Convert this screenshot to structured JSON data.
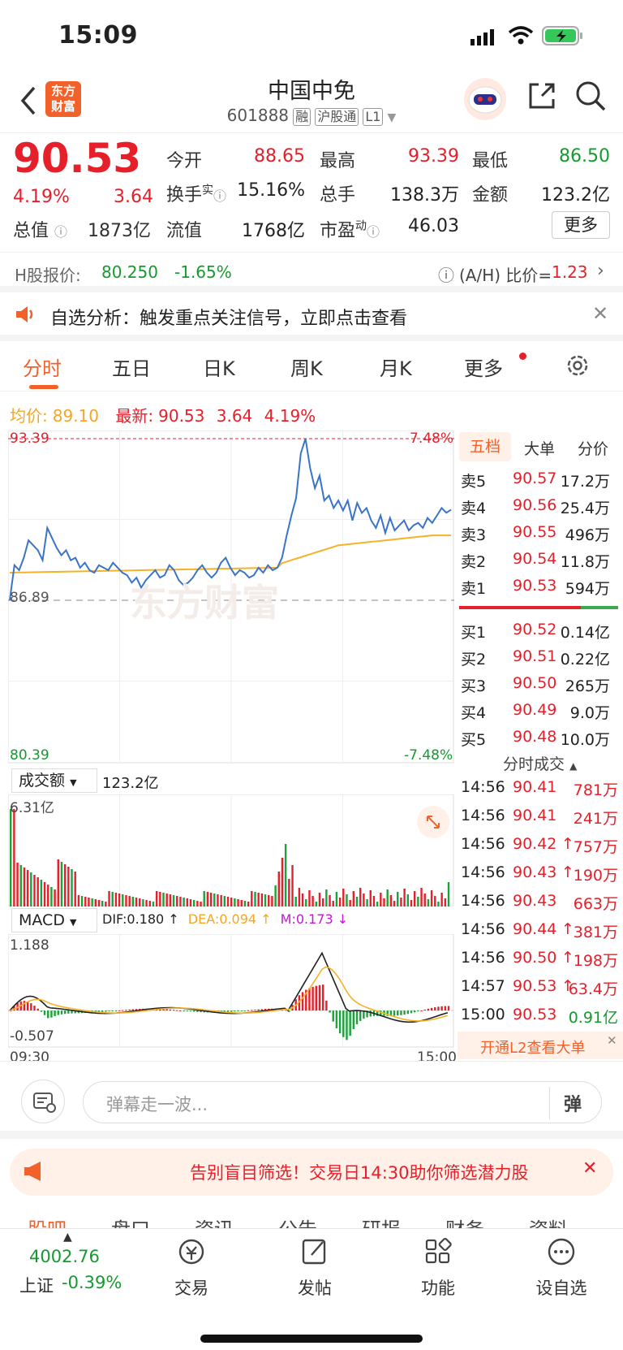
{
  "status": {
    "time": "15:09"
  },
  "header": {
    "title": "中国中免",
    "code": "601888",
    "tag_rong": "融",
    "tag_hgt": "沪股通",
    "tag_l1": "L1",
    "logo_line1": "东方",
    "logo_line2": "财富"
  },
  "quote": {
    "price": "90.53",
    "pct": "4.19%",
    "chg": "3.64",
    "open_label": "今开",
    "open": "88.65",
    "high_label": "最高",
    "high": "93.39",
    "low_label": "最低",
    "low": "86.50",
    "turnover_label": "换手",
    "turnover_sup": "实",
    "turnover": "15.16%",
    "volume_label": "总手",
    "volume": "138.3万",
    "amount_label": "金额",
    "amount": "123.2亿",
    "mktcap_label": "总值",
    "mktcap": "1873亿",
    "float_label": "流值",
    "float": "1768亿",
    "pe_label": "市盈",
    "pe_sup": "动",
    "pe": "46.03",
    "more": "更多"
  },
  "hshare": {
    "label": "H股报价:",
    "price": "80.250",
    "pct": "-1.65%",
    "ah_label": "(A/H) 比价=",
    "ah": "1.23"
  },
  "notice": {
    "text": "自选分析：触发重点关注信号，立即点击查看"
  },
  "tabs": [
    "分时",
    "五日",
    "日K",
    "周K",
    "月K",
    "更多"
  ],
  "info_line": {
    "avg_label": "均价:",
    "avg": "89.10",
    "latest_label": "最新:",
    "latest": "90.53",
    "chg": "3.64",
    "pct": "4.19%"
  },
  "chart_labels": {
    "top_price": "93.39",
    "top_pct": "7.48%",
    "mid_price": "86.89",
    "bot_price": "80.39",
    "bot_pct": "-7.48%",
    "watermark": "东方财富"
  },
  "volume_panel": {
    "label": "成交额",
    "value": "123.2亿",
    "max": "6.31亿"
  },
  "macd_panel": {
    "label": "MACD",
    "dif": "DIF:0.180 ↑",
    "dea": "DEA:0.094 ↑",
    "m": "M:0.173 ↓",
    "top": "1.188",
    "bottom": "-0.507",
    "t_start": "09:30",
    "t_end": "15:00"
  },
  "orderbook": {
    "tabs": [
      "五档",
      "大单",
      "分价"
    ],
    "asks": [
      {
        "label": "卖5",
        "price": "90.57",
        "vol": "17.2万"
      },
      {
        "label": "卖4",
        "price": "90.56",
        "vol": "25.4万"
      },
      {
        "label": "卖3",
        "price": "90.55",
        "vol": "496万"
      },
      {
        "label": "卖2",
        "price": "90.54",
        "vol": "11.8万"
      },
      {
        "label": "卖1",
        "price": "90.53",
        "vol": "594万"
      }
    ],
    "bids": [
      {
        "label": "买1",
        "price": "90.52",
        "vol": "0.14亿"
      },
      {
        "label": "买2",
        "price": "90.51",
        "vol": "0.22亿"
      },
      {
        "label": "买3",
        "price": "90.50",
        "vol": "265万"
      },
      {
        "label": "买4",
        "price": "90.49",
        "vol": "9.0万"
      },
      {
        "label": "买5",
        "price": "90.48",
        "vol": "10.0万"
      }
    ]
  },
  "ticks": {
    "title": "分时成交",
    "rows": [
      {
        "time": "14:56",
        "price": "90.41",
        "vol": "781万",
        "arrow": "",
        "vcolor": "red"
      },
      {
        "time": "14:56",
        "price": "90.41",
        "vol": "241万",
        "arrow": "",
        "vcolor": "red"
      },
      {
        "time": "14:56",
        "price": "90.42",
        "vol": "757万",
        "arrow": "↑",
        "vcolor": "red"
      },
      {
        "time": "14:56",
        "price": "90.43",
        "vol": "190万",
        "arrow": "↑",
        "vcolor": "red"
      },
      {
        "time": "14:56",
        "price": "90.43",
        "vol": "663万",
        "arrow": "",
        "vcolor": "red"
      },
      {
        "time": "14:56",
        "price": "90.44",
        "vol": "381万",
        "arrow": "↑",
        "vcolor": "red"
      },
      {
        "time": "14:56",
        "price": "90.50",
        "vol": "198万",
        "arrow": "↑",
        "vcolor": "red"
      },
      {
        "time": "14:57",
        "price": "90.53",
        "vol": "63.4万",
        "arrow": "↑",
        "vcolor": "red"
      },
      {
        "time": "15:00",
        "price": "90.53",
        "vol": "0.91亿",
        "arrow": "",
        "vcolor": "green"
      }
    ],
    "l2": "开通L2查看大单"
  },
  "comment": {
    "placeholder": "弹幕走一波...",
    "btn": "弹"
  },
  "promo": {
    "text": "告别盲目筛选！交易日14:30助你筛选潜力股"
  },
  "bottom_tabs_partial": [
    "股吧",
    "盘口",
    "资讯",
    "公告",
    "研报",
    "财务",
    "资料"
  ],
  "bottom_nav": {
    "index_value": "4002.76",
    "index_label": "上证",
    "index_pct": "-0.39%",
    "items": [
      "交易",
      "发帖",
      "功能",
      "设自选"
    ]
  },
  "chart_data": {
    "type": "line",
    "x_start": "09:30",
    "x_end": "15:00",
    "ylim": [
      80.39,
      93.39
    ],
    "prev_close": 86.89,
    "price_series": [
      86.89,
      88.3,
      88.1,
      88.6,
      89.3,
      89.1,
      88.9,
      88.5,
      89.8,
      89.4,
      89.0,
      88.7,
      88.9,
      88.5,
      88.6,
      88.2,
      88.4,
      88.1,
      88.0,
      88.3,
      88.2,
      88.1,
      88.4,
      88.2,
      88.0,
      87.9,
      87.6,
      87.8,
      87.4,
      87.7,
      87.9,
      88.1,
      87.8,
      87.9,
      88.3,
      88.1,
      87.7,
      87.5,
      87.6,
      87.8,
      88.1,
      88.3,
      88.0,
      87.8,
      88.0,
      88.4,
      88.6,
      88.2,
      87.9,
      88.1,
      88.0,
      87.8,
      87.9,
      88.2,
      88.0,
      88.3,
      88.1,
      88.2,
      88.6,
      89.5,
      90.3,
      91.0,
      92.8,
      93.39,
      92.2,
      91.4,
      91.9,
      90.9,
      91.1,
      90.6,
      90.9,
      90.5,
      90.9,
      90.1,
      90.8,
      90.4,
      90.6,
      90.1,
      89.8,
      90.3,
      89.6,
      90.2,
      89.7,
      89.9,
      90.1,
      89.7,
      89.9,
      90.0,
      89.8,
      90.2,
      90.0,
      90.3,
      90.6,
      90.41,
      90.53
    ],
    "avg_series_start": 88.0,
    "avg_series_end": 89.1,
    "macd_range": [
      -0.507,
      1.188
    ]
  }
}
